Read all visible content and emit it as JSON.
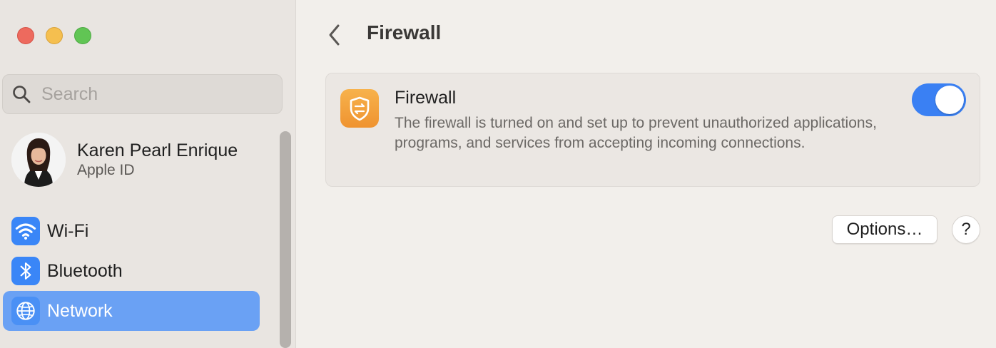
{
  "sidebar": {
    "search": {
      "placeholder": "Search",
      "value": ""
    },
    "profile": {
      "name": "Karen Pearl Enrique",
      "subtitle": "Apple ID"
    },
    "items": [
      {
        "label": "Wi-Fi",
        "icon": "wifi-icon",
        "selected": false
      },
      {
        "label": "Bluetooth",
        "icon": "bluetooth-icon",
        "selected": false
      },
      {
        "label": "Network",
        "icon": "globe-icon",
        "selected": true
      }
    ]
  },
  "header": {
    "title": "Firewall"
  },
  "firewall": {
    "title": "Firewall",
    "description": "The firewall is turned on and set up to prevent unauthorized applications, programs, and services from accepting incoming connections.",
    "enabled": true
  },
  "actions": {
    "options_label": "Options…",
    "help_label": "?"
  },
  "colors": {
    "accent": "#3a80f3",
    "selection": "#6aa1f4",
    "firewall_icon": "#f39d35"
  }
}
